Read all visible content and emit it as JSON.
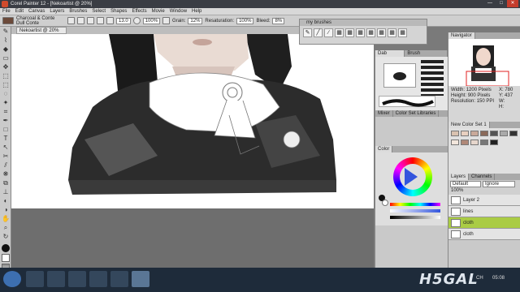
{
  "window": {
    "title": "Corel Painter 12 - [Nekoartist @ 20%]",
    "min": "—",
    "max": "□",
    "close": "✕"
  },
  "menu": [
    "File",
    "Edit",
    "Canvas",
    "Layers",
    "Brushes",
    "Select",
    "Shapes",
    "Effects",
    "Movie",
    "Window",
    "Help"
  ],
  "propbar": {
    "size": "13.0",
    "opacity": "100%",
    "grain_label": "Grain:",
    "grain": "12%",
    "resaturation_label": "Resaturation:",
    "resaturation": "100%",
    "bleed_label": "Bleed:",
    "bleed": "8%"
  },
  "brush_category": "Charcoal & Conte",
  "brush_variant": "Dull Conte",
  "doc_tab": "Nekoartist @ 20%",
  "brushes_panel": {
    "title": "my brushes",
    "items": [
      "✎",
      "╱",
      "∕",
      "▦",
      "▦",
      "▦",
      "▦",
      "▦",
      "▦",
      "▦"
    ]
  },
  "dab_panel": {
    "tabs": [
      "Dab Profile",
      "Brush Calibration"
    ],
    "mini_tabs": [
      "Mixer",
      "Color Set Libraries"
    ]
  },
  "color_panel": {
    "title": "Color"
  },
  "navigator": {
    "title": "Navigator",
    "width_label": "Width:",
    "width": "1200 Pixels",
    "height_label": "Height:",
    "height": "900 Pixels",
    "res_label": "Resolution:",
    "res": "150 PPI",
    "x_label": "X:",
    "x": "780",
    "y_label": "Y:",
    "y": "437",
    "w_label": "W:",
    "h_label": "H:"
  },
  "color_set": {
    "title": "New Color Set 1",
    "swatches": [
      "#d9c2b0",
      "#e8d0c0",
      "#c9a99a",
      "#8a6a5a",
      "#555555",
      "#aaaaaa",
      "#333333",
      "#f2e6dc",
      "#b08878",
      "#e6d6cc",
      "#777777",
      "#222222"
    ]
  },
  "layers": {
    "tabs": [
      "Layers",
      "Channels"
    ],
    "blend": "Default",
    "composite": "Ignore",
    "opacity": "100%",
    "items": [
      {
        "name": "Layer 2",
        "selected": false
      },
      {
        "name": "lines",
        "selected": false
      },
      {
        "name": "cloth",
        "selected": true
      },
      {
        "name": "cloth",
        "selected": false
      }
    ]
  },
  "watermark": "H5GAL",
  "clock": {
    "time": "05:08",
    "lang": "CH"
  },
  "colors": {
    "accent_layer": "#aacc44",
    "ui_bg": "#c9c9c9",
    "taskbar": "#1e2b3a",
    "hue_ring": "#3355dd"
  }
}
